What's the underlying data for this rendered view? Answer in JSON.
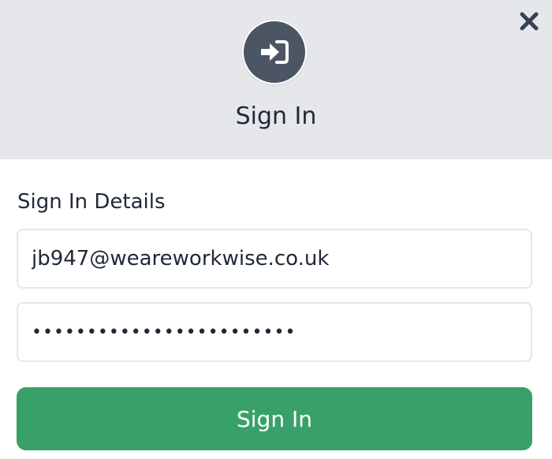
{
  "modal": {
    "title": "Sign In",
    "header_icon": "sign-in-icon",
    "close_icon": "close-icon"
  },
  "form": {
    "section_label": "Sign In Details",
    "email_value": "jb947@weareworkwise.co.uk",
    "password_value": "••••••••••••••••••••••••",
    "submit_label": "Sign In"
  },
  "colors": {
    "header_background": "#e5e7eb",
    "icon_circle": "#4b5563",
    "submit_button": "#38a169",
    "text": "#1f2937"
  }
}
